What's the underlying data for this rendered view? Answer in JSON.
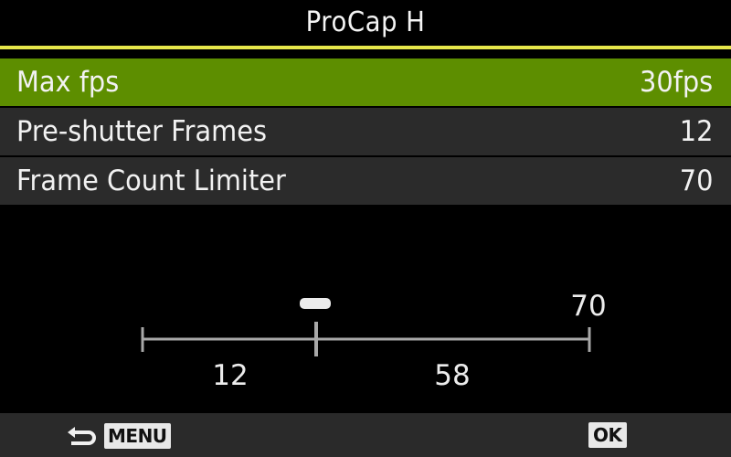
{
  "header": {
    "title": "ProCap H"
  },
  "menu": {
    "items": [
      {
        "label": "Max fps",
        "value": "30fps",
        "selected": true
      },
      {
        "label": "Pre-shutter Frames",
        "value": "12",
        "selected": false
      },
      {
        "label": "Frame Count Limiter",
        "value": "70",
        "selected": false
      }
    ]
  },
  "timeline": {
    "total_label": "70",
    "pre_shutter_label": "12",
    "post_shutter_label": "58",
    "shutter_icon": "shutter-marker-icon",
    "pre_shutter_frames": 12,
    "total_frames": 70
  },
  "footer": {
    "back_icon": "return-arrow-icon",
    "menu_key": "MENU",
    "ok_key": "OK"
  },
  "colors": {
    "background": "#000000",
    "accent_rule": "#e6e64a",
    "selected_row": "#5d8e00",
    "row": "#2b2b2b",
    "footer": "#2a2a2a"
  }
}
